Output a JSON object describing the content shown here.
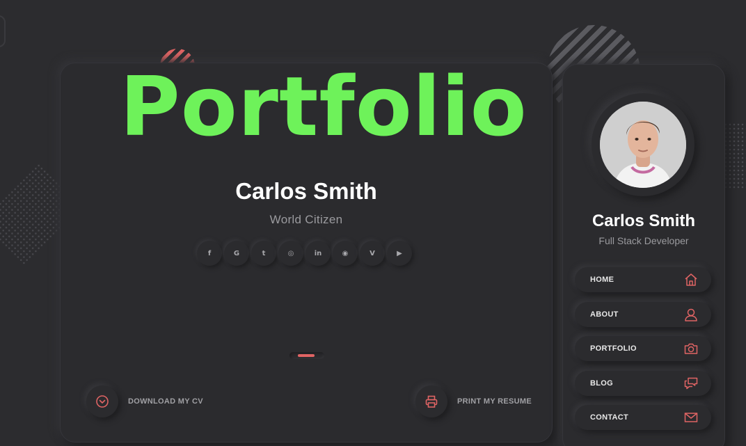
{
  "overlay": {
    "title": "Portfolio"
  },
  "hero": {
    "name_first": "Carlos",
    "name_last": "Smith",
    "role": "World Citizen",
    "social": [
      {
        "icon": "facebook-icon",
        "glyph": "f"
      },
      {
        "icon": "google-icon",
        "glyph": "G"
      },
      {
        "icon": "twitter-icon",
        "glyph": "t"
      },
      {
        "icon": "instagram-icon",
        "glyph": "◎"
      },
      {
        "icon": "linkedin-icon",
        "glyph": "in"
      },
      {
        "icon": "github-icon",
        "glyph": "◉"
      },
      {
        "icon": "vimeo-icon",
        "glyph": "V"
      },
      {
        "icon": "youtube-icon",
        "glyph": "▶"
      }
    ]
  },
  "actions": {
    "download_label": "DOWNLOAD MY CV",
    "print_label": "PRINT MY RESUME"
  },
  "sidebar": {
    "name_first": "Carlos",
    "name_last": "Smith",
    "role": "Full Stack Developer",
    "items": [
      {
        "label": "HOME",
        "icon": "home-icon"
      },
      {
        "label": "ABOUT",
        "icon": "user-icon"
      },
      {
        "label": "PORTFOLIO",
        "icon": "camera-icon"
      },
      {
        "label": "BLOG",
        "icon": "chat-icon"
      },
      {
        "label": "CONTACT",
        "icon": "mail-icon"
      }
    ]
  },
  "colors": {
    "accent": "#e06464",
    "overlay_title": "#6ef25a",
    "background": "#2c2c2f"
  }
}
